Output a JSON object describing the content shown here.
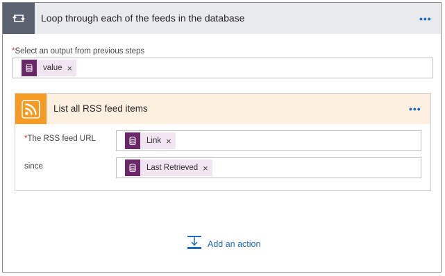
{
  "loop": {
    "title": "Loop through each of the feeds in the database",
    "icon": "loop-icon",
    "menu_dots": "•••",
    "select_output": {
      "required_mark": "*",
      "label": "Select an output from previous steps",
      "token": {
        "icon": "database-icon",
        "label": "value",
        "remove": "×"
      }
    }
  },
  "action": {
    "title": "List all RSS feed items",
    "icon": "rss-icon",
    "menu_dots": "•••",
    "fields": [
      {
        "required_mark": "*",
        "label": "The RSS feed URL",
        "token": {
          "icon": "database-icon",
          "label": "Link",
          "remove": "×"
        }
      },
      {
        "required_mark": "",
        "label": "since",
        "token": {
          "icon": "database-icon",
          "label": "Last Retrieved",
          "remove": "×"
        }
      }
    ]
  },
  "add_action": {
    "icon": "add-action-icon",
    "label": "Add an action"
  },
  "colors": {
    "accent": "#1e6bbd",
    "loop_header_bg": "#e9eaee",
    "loop_icon_bg": "#5b6270",
    "rss_orange": "#f59b23",
    "rss_header_bg": "#fdf0e0",
    "token_bg": "#f1e5f2",
    "token_icon_bg": "#6b2869",
    "required_red": "#c4262e"
  }
}
